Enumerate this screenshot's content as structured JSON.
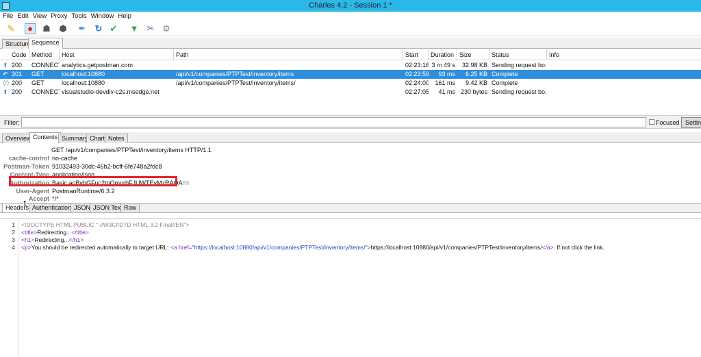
{
  "window": {
    "title": "Charles 4.2 - Session 1 *"
  },
  "menu": [
    "File",
    "Edit",
    "View",
    "Proxy",
    "Tools",
    "Window",
    "Help"
  ],
  "toolbar": {
    "buttons": [
      {
        "name": "broom-icon",
        "glyph": "✎"
      },
      {
        "name": "record-icon",
        "glyph": "●"
      },
      {
        "name": "turtle-icon",
        "glyph": "☗"
      },
      {
        "name": "stop-icon",
        "glyph": "⬢"
      },
      {
        "name": "pen-icon",
        "glyph": "✒"
      },
      {
        "name": "refresh-icon",
        "glyph": "↻"
      },
      {
        "name": "check-icon",
        "glyph": "✔"
      },
      {
        "name": "basket-icon",
        "glyph": "🧺"
      },
      {
        "name": "tools-icon",
        "glyph": "✂"
      },
      {
        "name": "gear-icon",
        "glyph": "⚙"
      }
    ]
  },
  "top_tabs": [
    "Structure",
    "Sequence"
  ],
  "table": {
    "columns": [
      "Code",
      "Method",
      "Host",
      "Path",
      "Start",
      "Duration",
      "Size",
      "Status",
      "Info"
    ],
    "rows": [
      {
        "code": "200",
        "method": "CONNECT",
        "host": "analytics.getpostman.com",
        "path": "",
        "start": "02:23:16",
        "duration": "3 m 49 s",
        "size": "32.98 KB",
        "status": "Sending request bo...",
        "info": ""
      },
      {
        "code": "301",
        "method": "GET",
        "host": "localhost:10880",
        "path": "/api/v1/companies/PTPTest/inventory/items",
        "start": "02:23:59",
        "duration": "93 ms",
        "size": "6.25 KB",
        "status": "Complete",
        "info": ""
      },
      {
        "code": "200",
        "method": "GET",
        "host": "localhost:10880",
        "path": "/api/v1/companies/PTPTest/inventory/items/",
        "start": "02:24:00",
        "duration": "161 ms",
        "size": "9.42 KB",
        "status": "Complete",
        "info": ""
      },
      {
        "code": "200",
        "method": "CONNECT",
        "host": "visualstudio-devdiv-c2s.msedge.net",
        "path": "",
        "start": "02:27:05",
        "duration": "41 ms",
        "size": "230 bytes",
        "status": "Sending request bo...",
        "info": ""
      }
    ]
  },
  "filter": {
    "label": "Filter:",
    "value": "",
    "focused_label": "Focused",
    "settings_label": "Settin"
  },
  "mid_tabs": [
    "Overview",
    "Contents",
    "Summary",
    "Chart",
    "Notes"
  ],
  "headers": {
    "request_line": "GET /api/v1/companies/PTPTest/inventory/items HTTP/1.1",
    "items": [
      {
        "key": "cache-control",
        "value": "no-cache"
      },
      {
        "key": "Postman-Token",
        "value": "91032493-30dc-46b2-bcff-6fe748a2fdc8"
      },
      {
        "key": "Content-Type",
        "value": "application/json"
      },
      {
        "key": "Authorization",
        "value": "Basic anBvbGFuc2tpOmprbFJUWTEyMzRAQA=="
      },
      {
        "key": "User-Agent",
        "value": "PostmanRuntime/6.3.2"
      },
      {
        "key": "Accept",
        "value": "*/*"
      }
    ]
  },
  "sub_tabs": [
    "Headers",
    "Authentication",
    "JSON",
    "JSON Text",
    "Raw"
  ],
  "code": {
    "line_numbers": [
      "1",
      "2",
      "3",
      "4"
    ],
    "l1": "<!DOCTYPE HTML PUBLIC \"-//W3C//DTD HTML 3.2 Final//EN\">",
    "l2_open": "<title>",
    "l2_text": "Redirecting...",
    "l2_close": "</title>",
    "l3_open": "<h1>",
    "l3_text": "Redirecting...",
    "l3_close": "</h1>",
    "l4_p": "<p>",
    "l4_text1": "You should be redirected automatically to target URL: ",
    "l4_a_open": "<a href=",
    "l4_href": "\"https://localhost:10880/api/v1/companies/PTPTest/inventory/items/\"",
    "l4_a_gt": ">",
    "l4_link": "https://localhost:10880/api/v1/companies/PTPTest/inventory/items/",
    "l4_a_close": "</a>",
    "l4_text2": ".  If not click the link."
  },
  "colors": {
    "titlebar": "#2bb7e8",
    "selection": "#2f8edc",
    "highlight_box": "#e0262c"
  }
}
